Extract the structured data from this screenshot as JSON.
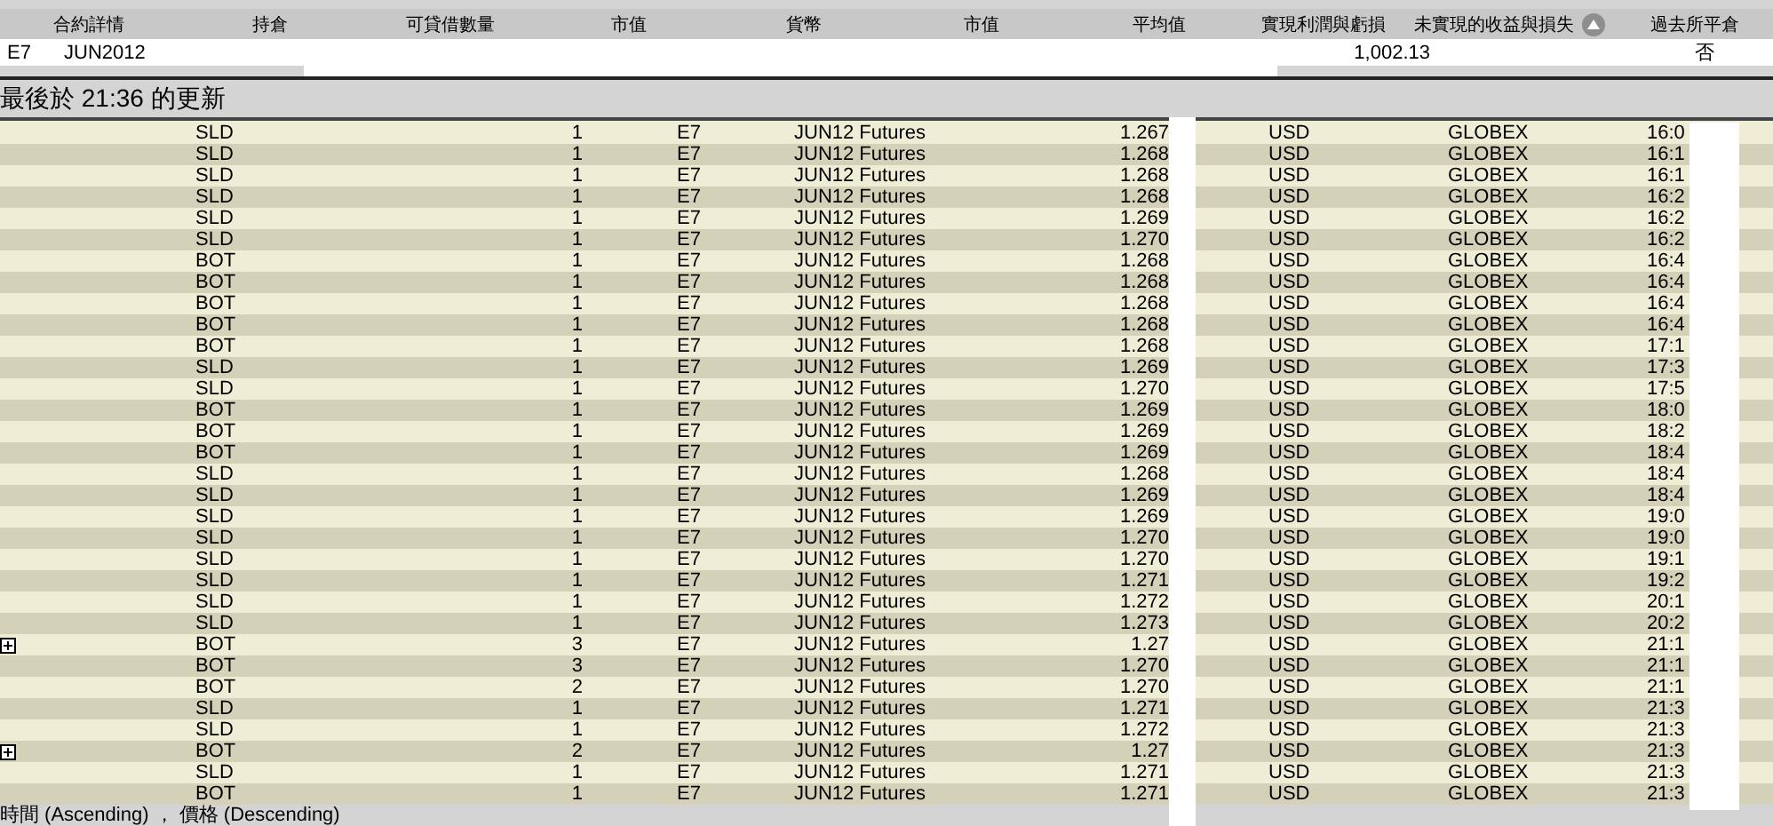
{
  "summary": {
    "columns": [
      "合約詳情",
      "持倉",
      "可貸借數量",
      "市值",
      "貨幣",
      "市值",
      "平均值",
      "實現利潤與虧損",
      "未實現的收益與損失",
      "過去所平倉"
    ],
    "row": {
      "symbol": "E7",
      "expiry": "JUN2012",
      "realized_pnl": "1,002.13",
      "closed_out": "否"
    }
  },
  "update_banner": "最後於 21:36 的更新",
  "trades": [
    {
      "expandable": false,
      "cells": [
        "SLD",
        "1",
        "E7",
        "JUN12 Futures",
        "1.267",
        "USD",
        "GLOBEX",
        "16:0"
      ]
    },
    {
      "expandable": false,
      "cells": [
        "SLD",
        "1",
        "E7",
        "JUN12 Futures",
        "1.268",
        "USD",
        "GLOBEX",
        "16:1"
      ]
    },
    {
      "expandable": false,
      "cells": [
        "SLD",
        "1",
        "E7",
        "JUN12 Futures",
        "1.268",
        "USD",
        "GLOBEX",
        "16:1"
      ]
    },
    {
      "expandable": false,
      "cells": [
        "SLD",
        "1",
        "E7",
        "JUN12 Futures",
        "1.268",
        "USD",
        "GLOBEX",
        "16:2"
      ]
    },
    {
      "expandable": false,
      "cells": [
        "SLD",
        "1",
        "E7",
        "JUN12 Futures",
        "1.269",
        "USD",
        "GLOBEX",
        "16:2"
      ]
    },
    {
      "expandable": false,
      "cells": [
        "SLD",
        "1",
        "E7",
        "JUN12 Futures",
        "1.270",
        "USD",
        "GLOBEX",
        "16:2"
      ]
    },
    {
      "expandable": false,
      "cells": [
        "BOT",
        "1",
        "E7",
        "JUN12 Futures",
        "1.268",
        "USD",
        "GLOBEX",
        "16:4"
      ]
    },
    {
      "expandable": false,
      "cells": [
        "BOT",
        "1",
        "E7",
        "JUN12 Futures",
        "1.268",
        "USD",
        "GLOBEX",
        "16:4"
      ]
    },
    {
      "expandable": false,
      "cells": [
        "BOT",
        "1",
        "E7",
        "JUN12 Futures",
        "1.268",
        "USD",
        "GLOBEX",
        "16:4"
      ]
    },
    {
      "expandable": false,
      "cells": [
        "BOT",
        "1",
        "E7",
        "JUN12 Futures",
        "1.268",
        "USD",
        "GLOBEX",
        "16:4"
      ]
    },
    {
      "expandable": false,
      "cells": [
        "BOT",
        "1",
        "E7",
        "JUN12 Futures",
        "1.268",
        "USD",
        "GLOBEX",
        "17:1"
      ]
    },
    {
      "expandable": false,
      "cells": [
        "SLD",
        "1",
        "E7",
        "JUN12 Futures",
        "1.269",
        "USD",
        "GLOBEX",
        "17:3"
      ]
    },
    {
      "expandable": false,
      "cells": [
        "SLD",
        "1",
        "E7",
        "JUN12 Futures",
        "1.270",
        "USD",
        "GLOBEX",
        "17:5"
      ]
    },
    {
      "expandable": false,
      "cells": [
        "BOT",
        "1",
        "E7",
        "JUN12 Futures",
        "1.269",
        "USD",
        "GLOBEX",
        "18:0"
      ]
    },
    {
      "expandable": false,
      "cells": [
        "BOT",
        "1",
        "E7",
        "JUN12 Futures",
        "1.269",
        "USD",
        "GLOBEX",
        "18:2"
      ]
    },
    {
      "expandable": false,
      "cells": [
        "BOT",
        "1",
        "E7",
        "JUN12 Futures",
        "1.269",
        "USD",
        "GLOBEX",
        "18:4"
      ]
    },
    {
      "expandable": false,
      "cells": [
        "SLD",
        "1",
        "E7",
        "JUN12 Futures",
        "1.268",
        "USD",
        "GLOBEX",
        "18:4"
      ]
    },
    {
      "expandable": false,
      "cells": [
        "SLD",
        "1",
        "E7",
        "JUN12 Futures",
        "1.269",
        "USD",
        "GLOBEX",
        "18:4"
      ]
    },
    {
      "expandable": false,
      "cells": [
        "SLD",
        "1",
        "E7",
        "JUN12 Futures",
        "1.269",
        "USD",
        "GLOBEX",
        "19:0"
      ]
    },
    {
      "expandable": false,
      "cells": [
        "SLD",
        "1",
        "E7",
        "JUN12 Futures",
        "1.270",
        "USD",
        "GLOBEX",
        "19:0"
      ]
    },
    {
      "expandable": false,
      "cells": [
        "SLD",
        "1",
        "E7",
        "JUN12 Futures",
        "1.270",
        "USD",
        "GLOBEX",
        "19:1"
      ]
    },
    {
      "expandable": false,
      "cells": [
        "SLD",
        "1",
        "E7",
        "JUN12 Futures",
        "1.271",
        "USD",
        "GLOBEX",
        "19:2"
      ]
    },
    {
      "expandable": false,
      "cells": [
        "SLD",
        "1",
        "E7",
        "JUN12 Futures",
        "1.272",
        "USD",
        "GLOBEX",
        "20:1"
      ]
    },
    {
      "expandable": false,
      "cells": [
        "SLD",
        "1",
        "E7",
        "JUN12 Futures",
        "1.273",
        "USD",
        "GLOBEX",
        "20:2"
      ]
    },
    {
      "expandable": true,
      "cells": [
        "BOT",
        "3",
        "E7",
        "JUN12 Futures",
        "1.27",
        "USD",
        "GLOBEX",
        "21:1"
      ]
    },
    {
      "expandable": false,
      "cells": [
        "BOT",
        "3",
        "E7",
        "JUN12 Futures",
        "1.270",
        "USD",
        "GLOBEX",
        "21:1"
      ]
    },
    {
      "expandable": false,
      "cells": [
        "BOT",
        "2",
        "E7",
        "JUN12 Futures",
        "1.270",
        "USD",
        "GLOBEX",
        "21:1"
      ]
    },
    {
      "expandable": false,
      "cells": [
        "SLD",
        "1",
        "E7",
        "JUN12 Futures",
        "1.271",
        "USD",
        "GLOBEX",
        "21:3"
      ]
    },
    {
      "expandable": false,
      "cells": [
        "SLD",
        "1",
        "E7",
        "JUN12 Futures",
        "1.272",
        "USD",
        "GLOBEX",
        "21:3"
      ]
    },
    {
      "expandable": true,
      "cells": [
        "BOT",
        "2",
        "E7",
        "JUN12 Futures",
        "1.27",
        "USD",
        "GLOBEX",
        "21:3"
      ]
    },
    {
      "expandable": false,
      "cells": [
        "SLD",
        "1",
        "E7",
        "JUN12 Futures",
        "1.271",
        "USD",
        "GLOBEX",
        "21:3"
      ]
    },
    {
      "expandable": false,
      "cells": [
        "BOT",
        "1",
        "E7",
        "JUN12 Futures",
        "1.271",
        "USD",
        "GLOBEX",
        "21:3"
      ]
    }
  ],
  "sort_footer": "時間 (Ascending) ， 價格 (Descending)"
}
